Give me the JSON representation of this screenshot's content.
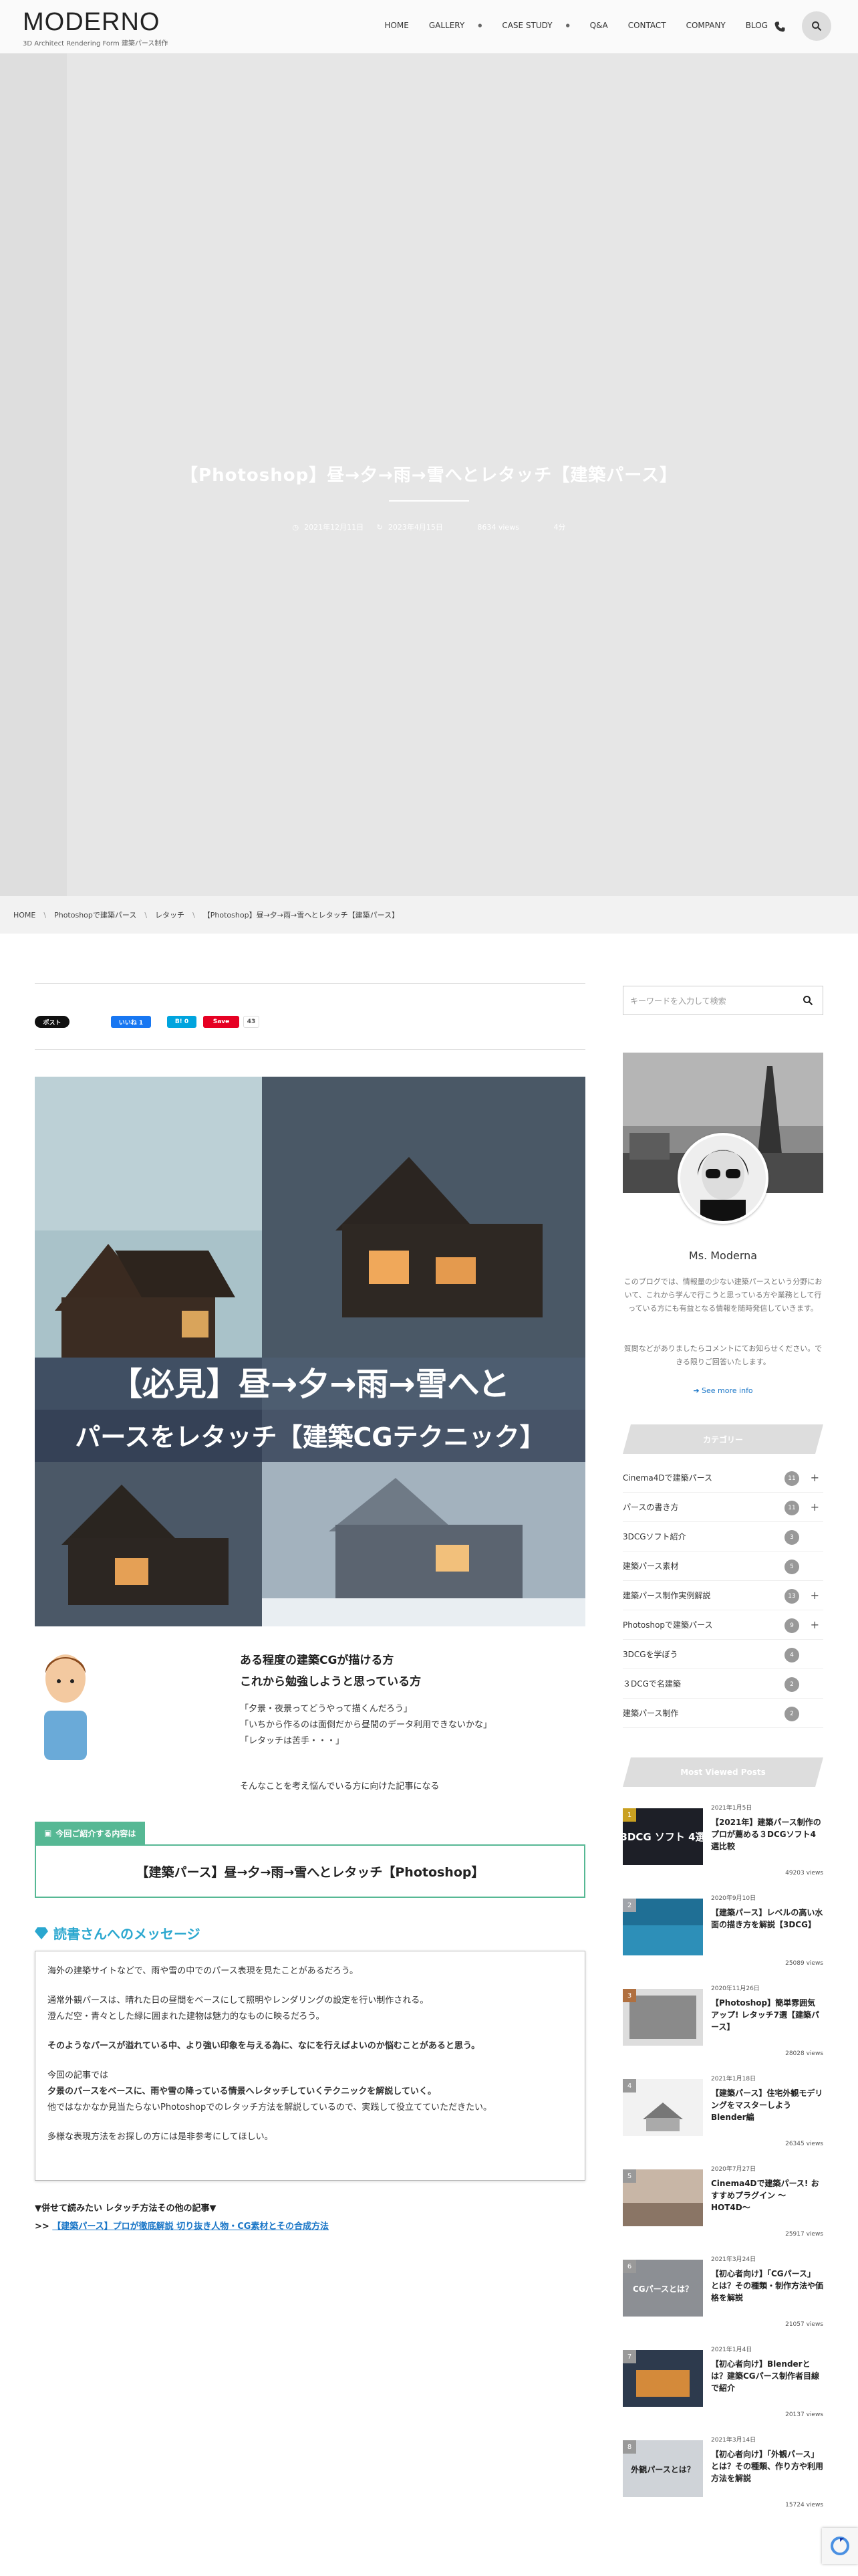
{
  "header": {
    "logo": "MODERNO",
    "tagline": "3D Architect Rendering Form 建築パース制作",
    "nav": [
      {
        "label": "HOME",
        "dropdown": false
      },
      {
        "label": "GALLERY",
        "dropdown": true
      },
      {
        "label": "CASE STUDY",
        "dropdown": true
      },
      {
        "label": "Q&A",
        "dropdown": false
      },
      {
        "label": "CONTACT",
        "dropdown": false
      },
      {
        "label": "COMPANY",
        "dropdown": false
      },
      {
        "label": "BLOG",
        "dropdown": false
      }
    ],
    "icons": [
      "phone-icon",
      "search-icon"
    ]
  },
  "hero": {
    "title": "【Photoshop】昼→夕→雨→雪へとレタッチ【建築パース】",
    "published": "2021年12月11日",
    "updated": "2023年4月15日",
    "views": "8634 views",
    "category": "4分"
  },
  "breadcrumb": [
    "HOME",
    "Photoshopで建築パース",
    "レタッチ",
    "【Photoshop】昼→夕→雨→雪へとレタッチ【建築パース】"
  ],
  "share": {
    "twitter": "ポスト",
    "facebook": "いいね 1",
    "hatena": "B! 0",
    "pinterest": "Save",
    "count": "43"
  },
  "featured": {
    "line1": "【必見】昼→夕→雨→雪へと",
    "line2": "パースをレタッチ【建築CGテクニック】"
  },
  "intro": {
    "lead1": "ある程度の建築CGが描ける方",
    "lead2": "これから勉強しようと思っている方",
    "q1": "「夕景・夜景ってどうやって描くんだろう」",
    "q2": "「いちから作るのは面倒だから昼間のデータ利用できないかな」",
    "q3": "「レタッチは苦手・・・」",
    "closing": "そんなことを考え悩んでいる方に向けた記事になる"
  },
  "recommend": {
    "tab": "今回ご紹介する内容は",
    "body": "【建築パース】昼→夕→雨→雪へとレタッチ【Photoshop】"
  },
  "message": {
    "heading": "読書さんへのメッセージ",
    "p1": "海外の建築サイトなどで、雨や雪の中でのパース表現を見たことがあるだろう。",
    "p2": "通常外観パースは、晴れた日の昼間をベースにして照明やレンダリングの設定を行い制作される。",
    "p3": "澄んだ空・青々とした緑に囲まれた建物は魅力的なものに映るだろう。",
    "p4": "そのようなパースが溢れている中、より強い印象を与える為に、なにを行えばよいのか悩むことがあると思う。",
    "p5": "今回の記事では",
    "p6": "夕景のパースをベースに、雨や雪の降っている情景へレタッチしていくテクニックを解説していく。",
    "p7": "他ではなかなか見当たらないPhotoshopでのレタッチ方法を解説しているので、実践して役立てていただきたい。",
    "p8": "多様な表現方法をお探しの方には是非参考にしてほしい。"
  },
  "further": {
    "heading": "▼併せて読みたい レタッチ方法その他の記事▼",
    "prefix": ">> ",
    "link": "【建築パース】プロが徹底解説 切り抜き人物・CG素材とその合成方法"
  },
  "sidebar": {
    "search_placeholder": "キーワードを入力して検索",
    "profile_name": "Ms. Moderna",
    "bio1": "このブログでは、情報量の少ない建築パースという分野において、これから学んで行こうと思っている方や業務として行っている方にも有益となる情報を随時発信していきます。",
    "bio2": "質問などがありましたらコメントにてお知らせください。できる限りご回答いたします。",
    "see_more": "See more info",
    "category_heading": "カテゴリー",
    "categories": [
      {
        "label": "Cinema4Dで建築パース",
        "count": "11",
        "plus": true
      },
      {
        "label": "パースの書き方",
        "count": "11",
        "plus": true
      },
      {
        "label": "3DCGソフト紹介",
        "count": "3",
        "plus": false
      },
      {
        "label": "建築パース素材",
        "count": "5",
        "plus": false
      },
      {
        "label": "建築パース制作実例解説",
        "count": "13",
        "plus": true
      },
      {
        "label": "Photoshopで建築パース",
        "count": "9",
        "plus": true
      },
      {
        "label": "3DCGを学ぼう",
        "count": "4",
        "plus": false
      },
      {
        "label": "３DCGで名建築",
        "count": "2",
        "plus": false
      },
      {
        "label": "建築パース制作",
        "count": "2",
        "plus": false
      }
    ],
    "most_viewed_heading": "Most Viewed Posts",
    "most_viewed": [
      {
        "rank": "1",
        "date": "2021年1月5日",
        "title": "【2021年】建築パース制作のプロが薦める３DCGソフト4選比較",
        "views": "49203 views",
        "thumb_text": "3DCG ソフト 4選"
      },
      {
        "rank": "2",
        "date": "2020年9月10日",
        "title": "【建築パース】レベルの高い水面の描き方を解説【3DCG】",
        "views": "25089 views",
        "thumb_text": ""
      },
      {
        "rank": "3",
        "date": "2020年11月26日",
        "title": "【Photoshop】簡単雰囲気アップ! レタッチ7選【建築パース】",
        "views": "28028 views",
        "thumb_text": ""
      },
      {
        "rank": "4",
        "date": "2021年1月18日",
        "title": "【建築パース】住宅外観モデリングをマスターしよう Blender編",
        "views": "26345 views",
        "thumb_text": ""
      },
      {
        "rank": "5",
        "date": "2020年7月27日",
        "title": "Cinema4Dで建築パース! おすすめプラグイン 〜HOT4D〜",
        "views": "25917 views",
        "thumb_text": ""
      },
      {
        "rank": "6",
        "date": "2021年3月24日",
        "title": "【初心者向け】「CGパース」とは？その種類・制作方法や価格を解説",
        "views": "21057 views",
        "thumb_text": "CGパースとは？"
      },
      {
        "rank": "7",
        "date": "2021年1月4日",
        "title": "【初心者向け】Blenderとは？建築CGパース制作者目線で紹介",
        "views": "20137 views",
        "thumb_text": ""
      },
      {
        "rank": "8",
        "date": "2021年3月14日",
        "title": "【初心者向け】「外観パース」とは？その種類、作り方や利用方法を解説",
        "views": "15724 views",
        "thumb_text": "外観パースとは？"
      }
    ]
  },
  "colors": {
    "accent_green": "#56b894",
    "accent_blue": "#2aa7cf",
    "link": "#1a76c7"
  }
}
